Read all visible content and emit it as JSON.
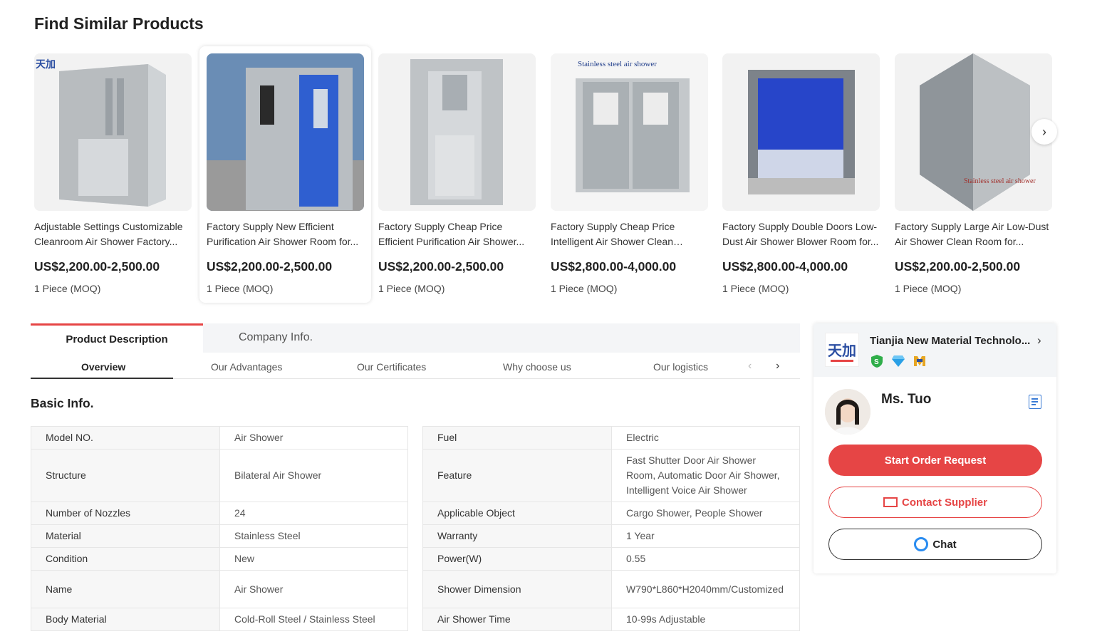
{
  "similar": {
    "title": "Find Similar Products",
    "products": [
      {
        "title": "Adjustable Settings Customizable Cleanroom Air Shower Factory...",
        "price": "US$2,200.00-2,500.00",
        "moq": "1 Piece (MOQ)"
      },
      {
        "title": "Factory Supply New Efficient Purification Air Shower Room for...",
        "price": "US$2,200.00-2,500.00",
        "moq": "1 Piece (MOQ)"
      },
      {
        "title": "Factory Supply Cheap Price Efficient Purification Air Shower...",
        "price": "US$2,200.00-2,500.00",
        "moq": "1 Piece (MOQ)"
      },
      {
        "title": "Factory Supply Cheap Price Intelligent Air Shower Clean Room...",
        "price": "US$2,800.00-4,000.00",
        "moq": "1 Piece (MOQ)"
      },
      {
        "title": "Factory Supply Double Doors Low-Dust Air Shower Blower Room for...",
        "price": "US$2,800.00-4,000.00",
        "moq": "1 Piece (MOQ)"
      },
      {
        "title": "Factory Supply Large Air Low-Dust Air Shower Clean Room for...",
        "price": "US$2,200.00-2,500.00",
        "moq": "1 Piece (MOQ)"
      }
    ],
    "image_captions": {
      "p4": "Stainless steel air shower",
      "p6": "Stainless steel air shower"
    }
  },
  "tabs": {
    "product_description": "Product Description",
    "company_info": "Company Info."
  },
  "subtabs": [
    "Overview",
    "Our Advantages",
    "Our Certificates",
    "Why choose us",
    "Our logistics"
  ],
  "basic_info": {
    "title": "Basic Info.",
    "left": [
      {
        "k": "Model NO.",
        "v": "Air Shower"
      },
      {
        "k": "Structure",
        "v": "Bilateral Air Shower"
      },
      {
        "k": "Number of Nozzles",
        "v": "24"
      },
      {
        "k": "Material",
        "v": "Stainless Steel"
      },
      {
        "k": "Condition",
        "v": "New"
      },
      {
        "k": "Name",
        "v": "Air Shower"
      },
      {
        "k": "Body Material",
        "v": "Cold-Roll Steel / Stainless Steel"
      }
    ],
    "right": [
      {
        "k": "Fuel",
        "v": "Electric"
      },
      {
        "k": "Feature",
        "v": "Fast Shutter Door Air Shower Room, Automatic Door Air Shower, Intelligent Voice Air Shower"
      },
      {
        "k": "Applicable Object",
        "v": "Cargo Shower, People Shower"
      },
      {
        "k": "Warranty",
        "v": "1 Year"
      },
      {
        "k": "Power(W)",
        "v": "0.55"
      },
      {
        "k": "Shower Dimension",
        "v": "W790*L860*H2040mm/Customized"
      },
      {
        "k": "Air Shower Time",
        "v": "10-99s Adjustable"
      }
    ]
  },
  "supplier": {
    "name": "Tianjia New Material Technolo...",
    "rep_name": "Ms. Tuo",
    "order_label": "Start Order Request",
    "contact_label": "Contact Supplier",
    "chat_label": "Chat"
  },
  "colors": {
    "accent": "#e64545",
    "chat_blue": "#2a8cf0"
  }
}
